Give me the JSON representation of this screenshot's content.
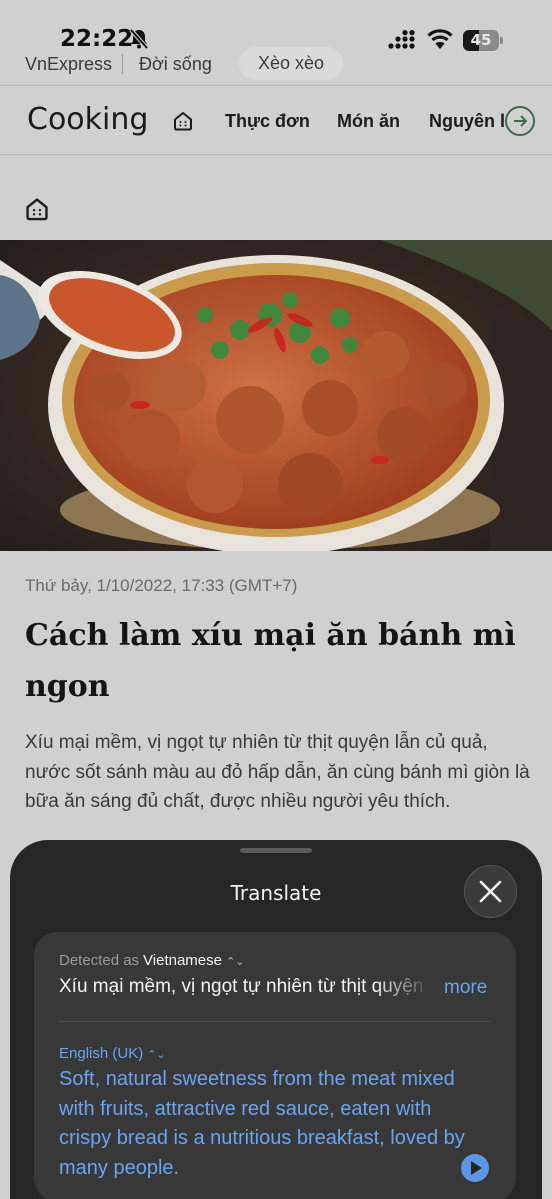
{
  "status": {
    "time": "22:22",
    "battery": "45",
    "battery_level": 0.45
  },
  "breadcrumb": {
    "site": "VnExpress",
    "section": "Đời sống",
    "tag": "Xèo xèo"
  },
  "nav": {
    "title": "Cooking",
    "items": [
      "Thực đơn",
      "Món ăn",
      "Nguyên l"
    ]
  },
  "article": {
    "date": "Thứ bảy, 1/10/2022, 17:33 (GMT+7)",
    "headline": "Cách làm xíu mại ăn bánh mì ngon",
    "lead": "Xíu mại mềm, vị ngọt tự nhiên từ thịt quyện lẫn củ quả, nước sốt sánh màu au đỏ hấp dẫn, ăn cùng bánh mì giòn là bữa ăn sáng đủ chất, được nhiều người yêu thích."
  },
  "translate": {
    "title": "Translate",
    "detected_prefix": "Detected as",
    "detected_language": "Vietnamese",
    "source_text": "Xíu mại mềm, vị ngọt tự nhiên từ thịt quyện",
    "more": "more",
    "target_language": "English (UK)",
    "translated_text": "Soft, natural sweetness from the meat mixed with fruits, attractive red sauce, eaten with crispy bread is a nutritious breakfast, loved by many people."
  }
}
